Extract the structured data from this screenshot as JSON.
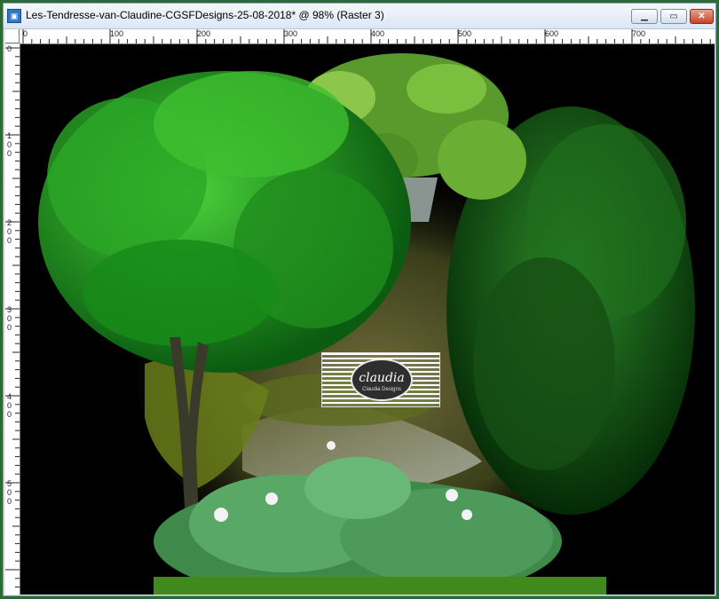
{
  "window": {
    "title": "Les-Tendresse-van-Claudine-CGSFDesigns-25-08-2018* @  98% (Raster 3)",
    "icon": "psp-image-icon",
    "controls": {
      "minimize": "minimize-icon",
      "maximize": "maximize-icon",
      "close": "close-icon"
    }
  },
  "ruler_top": {
    "labels": [
      "0",
      "100",
      "200",
      "300",
      "400",
      "500",
      "600",
      "700"
    ]
  },
  "ruler_left": {
    "labels": [
      [
        "0"
      ],
      [
        "1",
        "0",
        "0"
      ],
      [
        "2",
        "0",
        "0"
      ],
      [
        "3",
        "0",
        "0"
      ],
      [
        "4",
        "0",
        "0"
      ],
      [
        "5",
        "0",
        "0"
      ]
    ]
  },
  "canvas": {
    "watermark": {
      "name": "claudia",
      "sub": "Claudia Designs"
    },
    "colors": {
      "background": "#000000",
      "foliage_dark": "#0d5a12",
      "foliage_bright": "#2fb82a",
      "water": "#8a8f6a",
      "frame": "#2b6b33"
    }
  }
}
